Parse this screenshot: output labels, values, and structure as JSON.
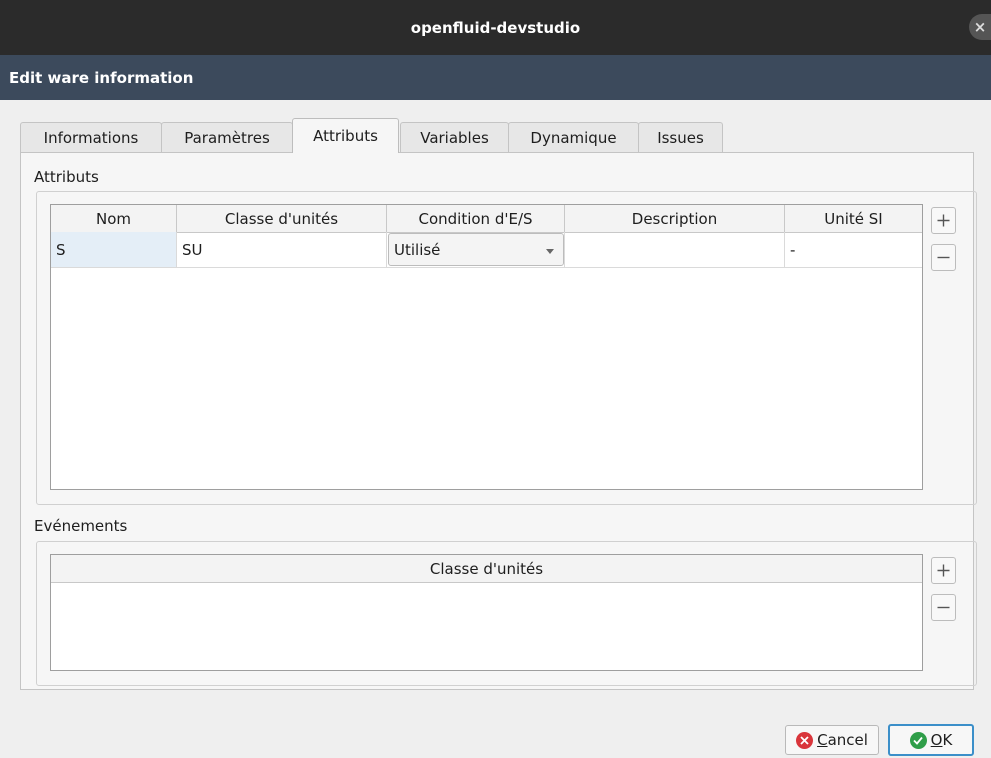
{
  "window": {
    "title": "openfluid-devstudio",
    "close_glyph": "×"
  },
  "dialog": {
    "header": "Edit ware information"
  },
  "tabs": [
    {
      "label": "Informations",
      "active": false
    },
    {
      "label": "Paramètres",
      "active": false
    },
    {
      "label": "Attributs",
      "active": true
    },
    {
      "label": "Variables",
      "active": false
    },
    {
      "label": "Dynamique",
      "active": false
    },
    {
      "label": "Issues",
      "active": false
    }
  ],
  "attributes": {
    "section_title": "Attributs",
    "columns": [
      "Nom",
      "Classe d'unités",
      "Condition d'E/S",
      "Description",
      "Unité SI"
    ],
    "rows": [
      {
        "nom": "S",
        "classe": "SU",
        "condition": "Utilisé",
        "description": "",
        "unite": "-"
      }
    ],
    "add_icon": "plus-icon",
    "remove_icon": "minus-icon"
  },
  "events": {
    "section_title": "Evénements",
    "columns": [
      "Classe d'unités"
    ],
    "rows": [],
    "add_icon": "plus-icon",
    "remove_icon": "minus-icon"
  },
  "buttons": {
    "cancel": {
      "label": "Cancel",
      "icon": "cancel-icon",
      "icon_color": "#d9353b"
    },
    "ok": {
      "label": "OK",
      "icon": "check-icon",
      "icon_color": "#2f9e49"
    }
  },
  "colors": {
    "titlebar": "#2b2b2b",
    "header": "#3c4a5c",
    "focus_border": "#3b8fc9",
    "selected_cell": "#e4eef7"
  }
}
